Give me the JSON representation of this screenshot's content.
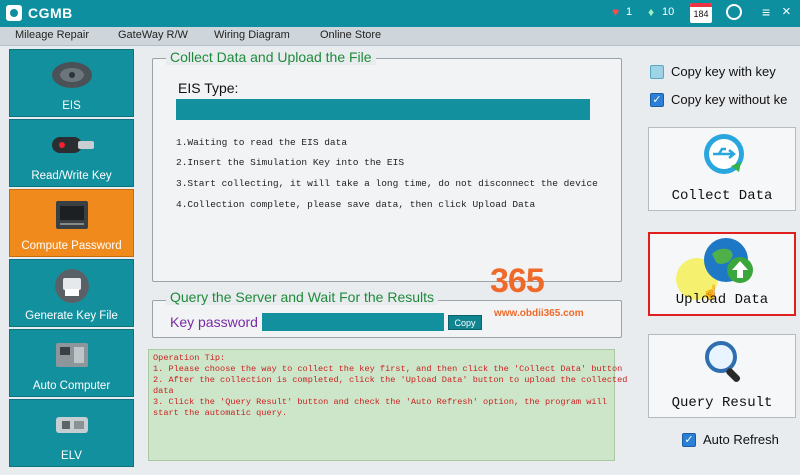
{
  "app": {
    "title": "CGMB"
  },
  "titlebar": {
    "heart_count": "1",
    "gem_count": "10",
    "counter": "184"
  },
  "menu": [
    "Mileage Repair",
    "GateWay R/W",
    "Wiring Diagram",
    "Online Store"
  ],
  "sidebar": [
    {
      "label": "EIS",
      "icon": "key-fob-icon"
    },
    {
      "label": "Read/Write Key",
      "icon": "smart-key-icon"
    },
    {
      "label": "Compute Password",
      "icon": "password-card-icon"
    },
    {
      "label": "Generate Key File",
      "icon": "printer-icon"
    },
    {
      "label": "Auto Computer",
      "icon": "ecu-icon"
    },
    {
      "label": "ELV",
      "icon": "steering-lock-icon"
    }
  ],
  "collect": {
    "title": "Collect Data and Upload the File",
    "eis_label": "EIS Type:",
    "steps": [
      "1.Waiting to read the EIS data",
      "2.Insert the Simulation Key into the EIS",
      "3.Start collecting, it will take a long time, do not disconnect the device",
      "4.Collection complete, please save data, then click Upload Data"
    ]
  },
  "query": {
    "title": "Query the Server and Wait For the Results",
    "key_password_label": "Key password",
    "copy_label": "Copy"
  },
  "tip": {
    "lines": [
      "Operation Tip:",
      "1. Please choose the way to collect the key first, and then click the 'Collect Data' button",
      "2. After the collection is completed, click the 'Upload Data' button to upload the collected",
      "   data",
      "3. Click the 'Query Result' button and check the 'Auto Refresh' option, the program will",
      "   start the automatic query."
    ]
  },
  "options": {
    "copy_with_key": "Copy key with key",
    "copy_without_key": "Copy key without ke"
  },
  "buttons": {
    "collect": "Collect Data",
    "upload": "Upload Data",
    "query": "Query Result"
  },
  "auto_refresh": "Auto Refresh",
  "watermark": {
    "logo_text": "365",
    "url": "www.obdii365.com"
  }
}
